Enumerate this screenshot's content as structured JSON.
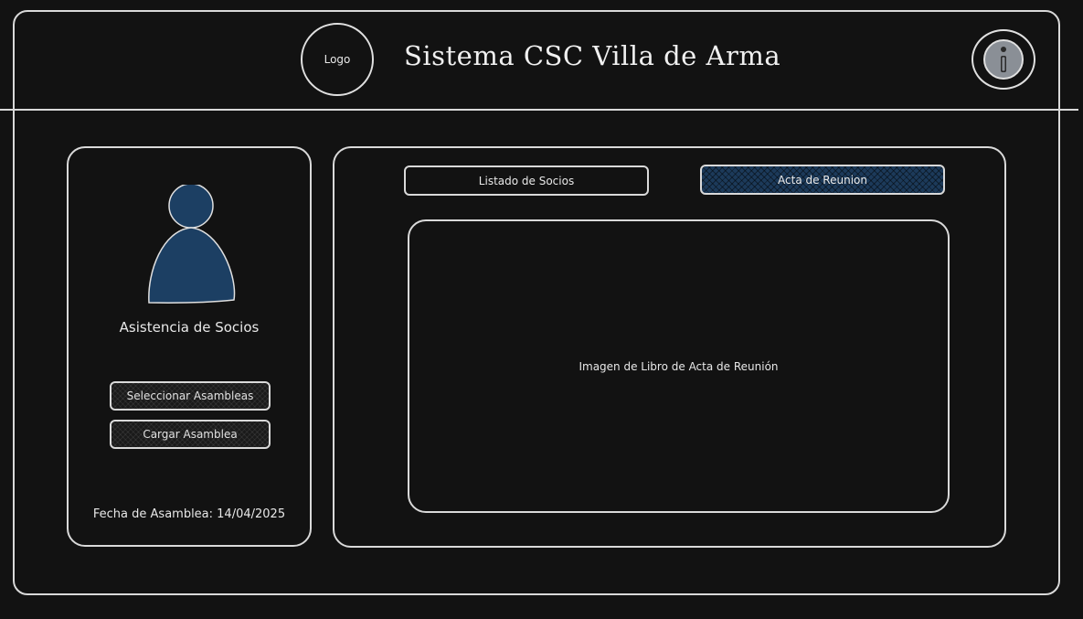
{
  "header": {
    "logo_label": "Logo",
    "title": "Sistema CSC Villa de Arma",
    "info_icon": "info-icon"
  },
  "sidebar": {
    "avatar_icon": "user-avatar-icon",
    "avatar_color": "#1c3f63",
    "title": "Asistencia de Socios",
    "buttons": {
      "select": "Seleccionar Asambleas",
      "load": "Cargar Asamblea"
    },
    "date": "Fecha de Asamblea: 14/04/2025"
  },
  "main": {
    "tabs": [
      {
        "label": "Listado de Socios",
        "active": false
      },
      {
        "label": "Acta de Reunion",
        "active": true
      }
    ],
    "accent_color": "#1c3a5a",
    "content_placeholder": "Imagen de Libro de Acta de Reunión"
  }
}
